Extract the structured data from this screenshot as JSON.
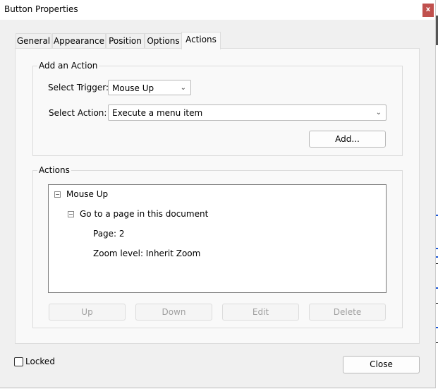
{
  "window": {
    "title": "Button Properties",
    "close_label": "x"
  },
  "tabs": [
    {
      "label": "General"
    },
    {
      "label": "Appearance"
    },
    {
      "label": "Position"
    },
    {
      "label": "Options"
    },
    {
      "label": "Actions",
      "active": true
    }
  ],
  "add_action": {
    "group_label": "Add an Action",
    "trigger_label": "Select Trigger:",
    "trigger_value": "Mouse Up",
    "action_label": "Select Action:",
    "action_value": "Execute a menu item",
    "add_button": "Add..."
  },
  "actions": {
    "group_label": "Actions",
    "tree": {
      "trigger": "Mouse Up",
      "action": "Go to a page in this document",
      "page": "Page: 2",
      "zoom": "Zoom level: Inherit Zoom"
    },
    "buttons": {
      "up": "Up",
      "down": "Down",
      "edit": "Edit",
      "delete": "Delete"
    }
  },
  "footer": {
    "locked_label": "Locked",
    "locked": false,
    "close_button": "Close"
  }
}
